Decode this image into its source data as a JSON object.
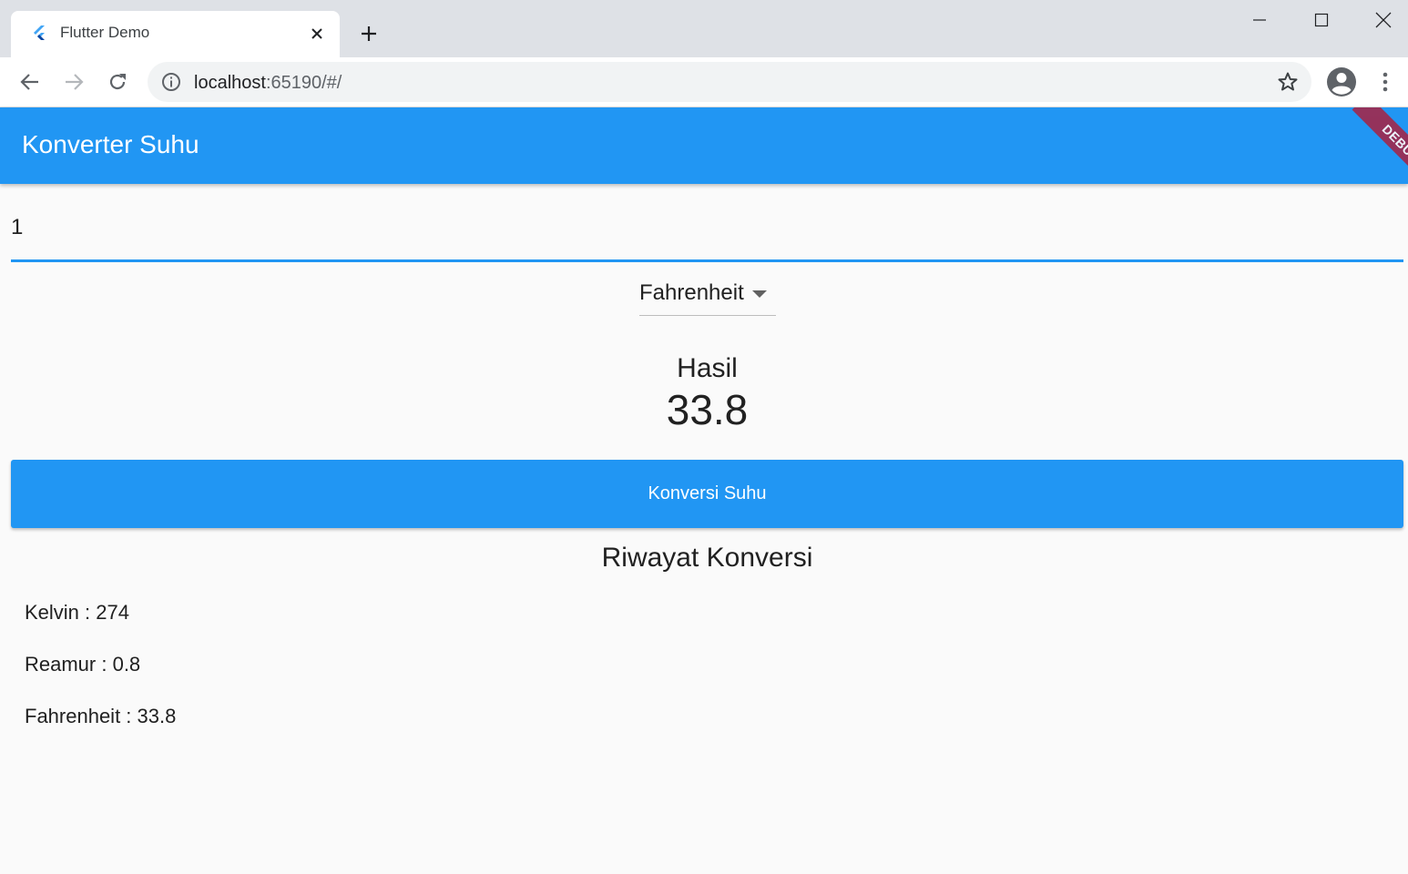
{
  "browser": {
    "tab_title": "Flutter Demo",
    "url_host": "localhost",
    "url_rest": ":65190/#/",
    "icons": [
      "flutter-logo-icon",
      "close-icon",
      "plus-icon",
      "minimize-icon",
      "maximize-icon",
      "window-close-icon",
      "back-arrow-icon",
      "forward-arrow-icon",
      "reload-icon",
      "info-icon",
      "star-icon",
      "account-icon",
      "more-vert-icon"
    ]
  },
  "app": {
    "title": "Konverter Suhu",
    "debug_banner": "DEBUG",
    "input_value": "1",
    "dropdown_selected": "Fahrenheit",
    "result_label": "Hasil",
    "result_value": "33.8",
    "convert_button": "Konversi Suhu",
    "history_title": "Riwayat Konversi",
    "history": [
      "Kelvin : 274",
      "Reamur : 0.8",
      "Fahrenheit : 33.8"
    ],
    "colors": {
      "primary": "#2196f3",
      "background": "#fafafa",
      "debug_banner": "#9e2a4f"
    }
  }
}
